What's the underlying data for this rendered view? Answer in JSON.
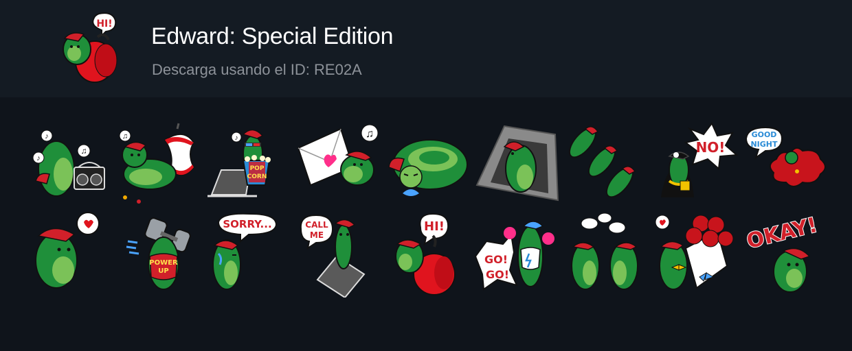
{
  "header": {
    "title": "Edward: Special Edition",
    "subtitle": "Descarga usando el ID: RE02A",
    "icon_text": "HI!"
  },
  "sticker_texts": {
    "popcorn_top": "POP",
    "popcorn_bottom": "CORN",
    "no": "NO!",
    "good": "GOOD",
    "night": "NIGHT",
    "sorry": "SORRY...",
    "power": "POWER",
    "up": "UP",
    "call": "CALL",
    "me": "ME",
    "hi": "HI!",
    "go1": "GO!",
    "go2": "GO!",
    "okay": "OKAY!"
  },
  "stickers": [
    {
      "name": "music-boombox"
    },
    {
      "name": "eating-apple"
    },
    {
      "name": "popcorn-laptop"
    },
    {
      "name": "love-letter"
    },
    {
      "name": "curled-sleeping"
    },
    {
      "name": "in-hole"
    },
    {
      "name": "three-worms"
    },
    {
      "name": "no-rapper"
    },
    {
      "name": "good-night"
    },
    {
      "name": "heart"
    },
    {
      "name": "power-up-dumbbell"
    },
    {
      "name": "sorry-crying"
    },
    {
      "name": "call-me-phone"
    },
    {
      "name": "hi-apple"
    },
    {
      "name": "go-go-cheer"
    },
    {
      "name": "gossip-pair"
    },
    {
      "name": "roses-bouquet"
    },
    {
      "name": "okay"
    }
  ],
  "colors": {
    "page_bg": "#0f141b",
    "header_bg": "#141b23",
    "title": "#ffffff",
    "subtitle": "#8d9299",
    "worm_green": "#1f8f3a",
    "worm_light": "#7bc258",
    "cap_red": "#d1202a",
    "apple_red": "#e0141e"
  }
}
